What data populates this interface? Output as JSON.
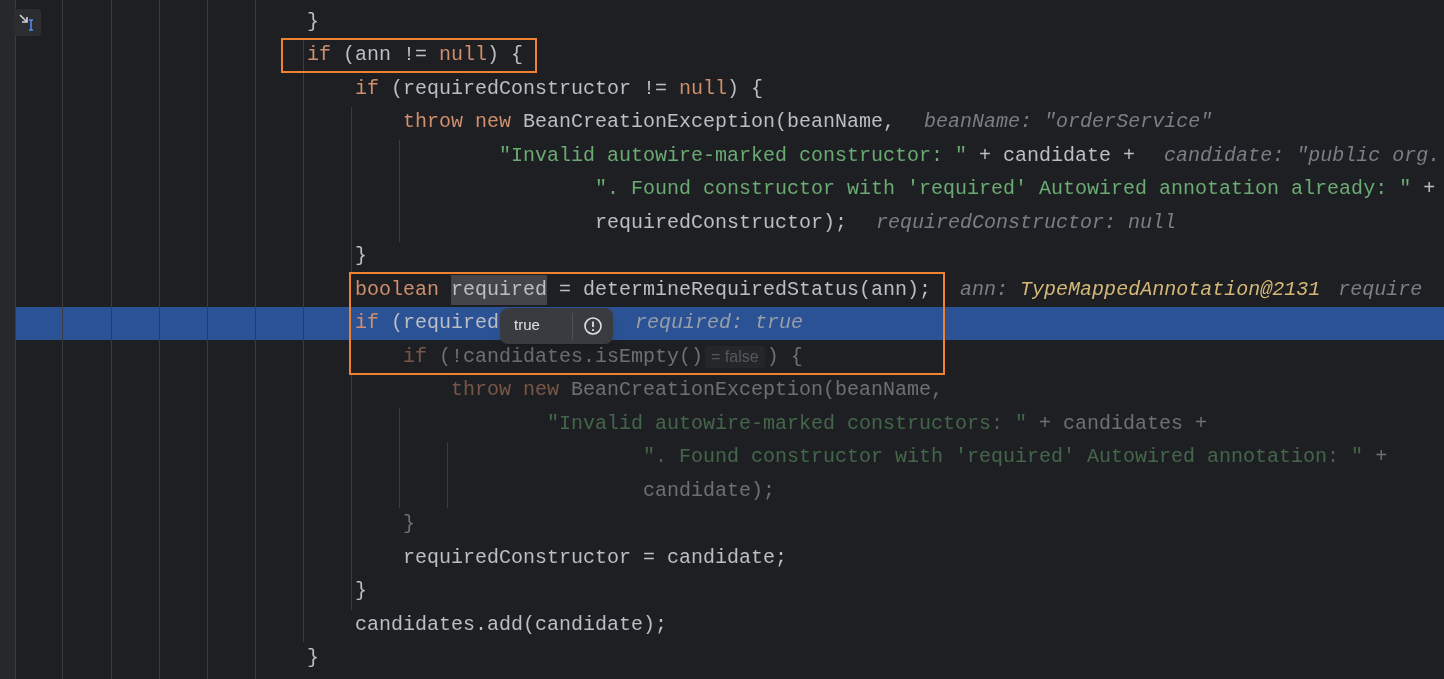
{
  "lines": [
    {
      "continuation": false,
      "dimmed": false,
      "current": false,
      "framed": false,
      "tokens": [
        {
          "kind": "plain",
          "text": "}"
        }
      ]
    },
    {
      "continuation": false,
      "dimmed": false,
      "current": false,
      "framed": true,
      "tokens": [
        {
          "kind": "keyword",
          "text": "if"
        },
        {
          "kind": "plain",
          "text": " (ann != "
        },
        {
          "kind": "keyword",
          "text": "null"
        },
        {
          "kind": "plain",
          "text": ") {"
        }
      ],
      "children": [
        {
          "continuation": false,
          "dimmed": false,
          "current": false,
          "framed": false,
          "tokens": [
            {
              "kind": "keyword",
              "text": "if"
            },
            {
              "kind": "plain",
              "text": " (requiredConstructor != "
            },
            {
              "kind": "keyword",
              "text": "null"
            },
            {
              "kind": "plain",
              "text": ") {"
            }
          ],
          "children": [
            {
              "continuation": false,
              "dimmed": false,
              "current": false,
              "framed": false,
              "tokens": [
                {
                  "kind": "keyword",
                  "text": "throw new"
                },
                {
                  "kind": "plain",
                  "text": " BeanCreationException(beanName,"
                },
                {
                  "kind": "hint",
                  "text": "beanName: \"orderService\""
                }
              ],
              "children": [
                {
                  "continuation": true,
                  "dimmed": false,
                  "current": false,
                  "framed": false,
                  "tokens": [
                    {
                      "kind": "string",
                      "text": "\"Invalid autowire-marked constructor: \""
                    },
                    {
                      "kind": "plain",
                      "text": " + candidate +"
                    },
                    {
                      "kind": "hint",
                      "text": "candidate: \"public org."
                    }
                  ],
                  "children": [
                    {
                      "continuation": true,
                      "dimmed": false,
                      "current": false,
                      "framed": false,
                      "tokens": [
                        {
                          "kind": "string",
                          "text": "\". Found constructor with 'required' Autowired annotation already: \""
                        },
                        {
                          "kind": "plain",
                          "text": " +"
                        }
                      ]
                    },
                    {
                      "continuation": true,
                      "dimmed": false,
                      "current": false,
                      "framed": false,
                      "tokens": [
                        {
                          "kind": "plain",
                          "text": "requiredConstructor);"
                        },
                        {
                          "kind": "hint",
                          "text": "requiredConstructor: null"
                        }
                      ]
                    }
                  ]
                }
              ]
            }
          ]
        },
        {
          "continuation": false,
          "dimmed": false,
          "current": false,
          "framed": false,
          "tokens": [
            {
              "kind": "plain",
              "text": "}"
            }
          ]
        },
        {
          "continuation": false,
          "dimmed": false,
          "current": false,
          "framed": true,
          "tokens": [
            {
              "kind": "keyword",
              "text": "boolean"
            },
            {
              "kind": "selection",
              "text": "required"
            },
            {
              "kind": "plain",
              "text": " = determineRequiredStatus(ann);"
            },
            {
              "kind": "hint",
              "text": "ann:"
            },
            {
              "kind": "hint_value",
              "text": "TypeMappedAnnotation@2131"
            },
            {
              "kind": "hint",
              "text": "require"
            }
          ]
        },
        {
          "continuation": false,
          "dimmed": false,
          "current": true,
          "framed": true,
          "tokens": [
            {
              "kind": "keyword",
              "text": "if"
            },
            {
              "kind": "plain",
              "text": " (required"
            },
            {
              "kind": "hint_far",
              "text": "required: true"
            }
          ],
          "children": [
            {
              "continuation": false,
              "dimmed": true,
              "current": false,
              "framed": true,
              "tokens": [
                {
                  "kind": "keyword",
                  "text": "if"
                },
                {
                  "kind": "plain",
                  "text": " (!candidates.isEmpty()"
                },
                {
                  "kind": "badge",
                  "text": "= false"
                },
                {
                  "kind": "plain",
                  "text": ") {"
                }
              ],
              "children": [
                {
                  "continuation": false,
                  "dimmed": true,
                  "current": false,
                  "framed": false,
                  "tokens": [
                    {
                      "kind": "keyword",
                      "text": "throw new"
                    },
                    {
                      "kind": "plain",
                      "text": " BeanCreationException(beanName,"
                    }
                  ],
                  "children": [
                    {
                      "continuation": true,
                      "dimmed": true,
                      "current": false,
                      "framed": false,
                      "tokens": [
                        {
                          "kind": "string",
                          "text": "\"Invalid autowire-marked constructors: \""
                        },
                        {
                          "kind": "plain",
                          "text": " + candidates +"
                        }
                      ],
                      "children": [
                        {
                          "continuation": true,
                          "dimmed": true,
                          "current": false,
                          "framed": false,
                          "tokens": [
                            {
                              "kind": "string",
                              "text": "\". Found constructor with 'required' Autowired annotation: \""
                            },
                            {
                              "kind": "plain",
                              "text": " +"
                            }
                          ]
                        },
                        {
                          "continuation": true,
                          "dimmed": true,
                          "current": false,
                          "framed": false,
                          "tokens": [
                            {
                              "kind": "plain",
                              "text": "candidate);"
                            }
                          ]
                        }
                      ]
                    }
                  ]
                }
              ]
            },
            {
              "continuation": false,
              "dimmed": true,
              "current": false,
              "framed": false,
              "tokens": [
                {
                  "kind": "plain",
                  "text": "}"
                }
              ]
            },
            {
              "continuation": false,
              "dimmed": false,
              "current": false,
              "framed": false,
              "tokens": [
                {
                  "kind": "plain",
                  "text": "requiredConstructor = candidate;"
                }
              ]
            }
          ]
        },
        {
          "continuation": false,
          "dimmed": false,
          "current": false,
          "framed": false,
          "tokens": [
            {
              "kind": "plain",
              "text": "}"
            }
          ]
        },
        {
          "continuation": false,
          "dimmed": false,
          "current": false,
          "framed": false,
          "tokens": [
            {
              "kind": "plain",
              "text": "candidates.add(candidate);"
            }
          ]
        }
      ]
    },
    {
      "continuation": false,
      "dimmed": false,
      "current": false,
      "framed": false,
      "tokens": [
        {
          "kind": "plain",
          "text": "}"
        }
      ]
    }
  ],
  "popup": {
    "text": "true"
  }
}
